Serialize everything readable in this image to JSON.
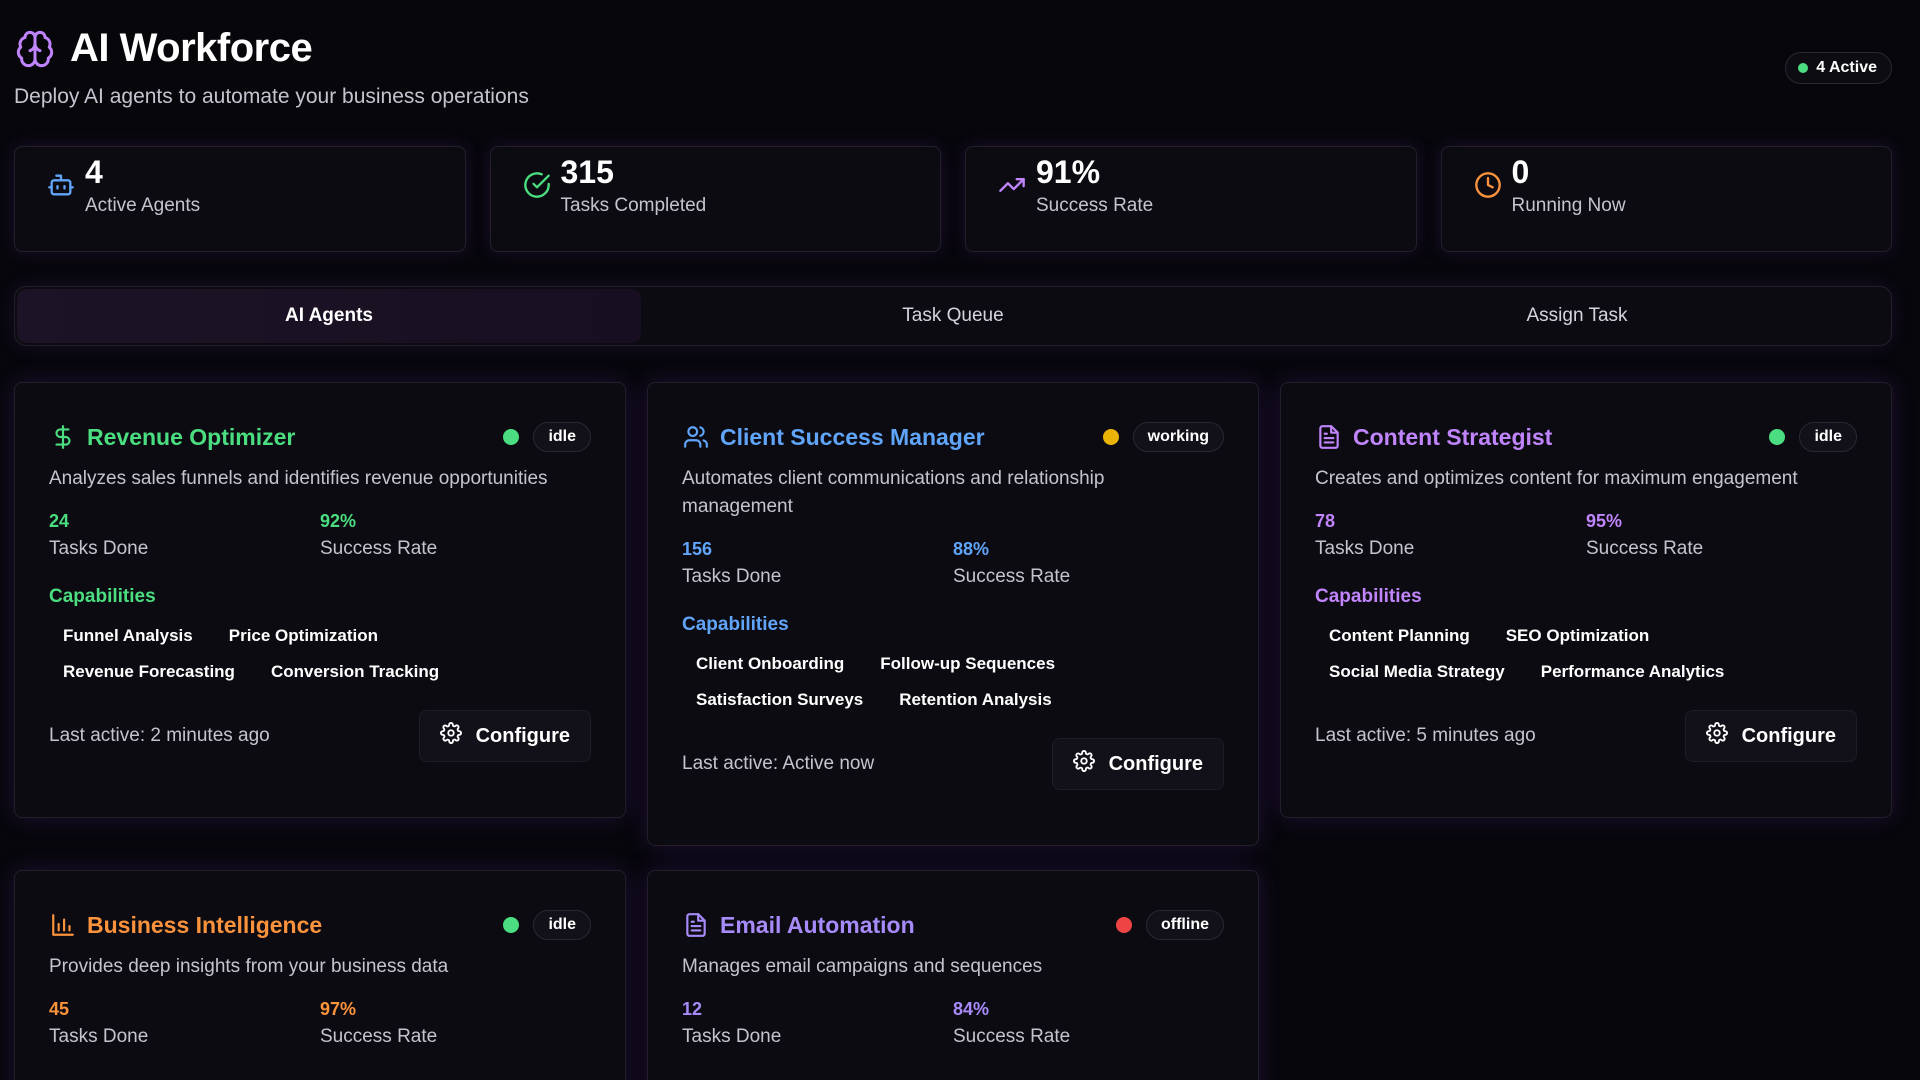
{
  "header": {
    "title": "AI Workforce",
    "subtitle": "Deploy AI agents to automate your business operations",
    "active_badge": "4 Active"
  },
  "colors": {
    "green": "#4ade80",
    "blue": "#60a5fa",
    "purple": "#c084fc",
    "orange": "#fb923c",
    "violet": "#a78bfa",
    "yellow": "#eab308",
    "red": "#ef4444"
  },
  "stats": [
    {
      "icon": "robot-icon",
      "value": "4",
      "label": "Active Agents"
    },
    {
      "icon": "check-circle-icon",
      "value": "315",
      "label": "Tasks Completed"
    },
    {
      "icon": "trending-up-icon",
      "value": "91%",
      "label": "Success Rate"
    },
    {
      "icon": "clock-icon",
      "value": "0",
      "label": "Running Now"
    }
  ],
  "tabs": [
    {
      "label": "AI Agents",
      "active": true
    },
    {
      "label": "Task Queue",
      "active": false
    },
    {
      "label": "Assign Task",
      "active": false
    }
  ],
  "agents": [
    {
      "name": "Revenue Optimizer",
      "icon": "dollar-icon",
      "status": "idle",
      "description": "Analyzes sales funnels and identifies revenue opportunities",
      "tasks_done": "24",
      "tasks_done_label": "Tasks Done",
      "success_rate": "92%",
      "success_rate_label": "Success Rate",
      "capabilities_title": "Capabilities",
      "capabilities": [
        "Funnel Analysis",
        "Price Optimization",
        "Revenue Forecasting",
        "Conversion Tracking"
      ],
      "last_active": "Last active: 2 minutes ago",
      "configure_label": "Configure"
    },
    {
      "name": "Client Success Manager",
      "icon": "users-icon",
      "status": "working",
      "description": "Automates client communications and relationship management",
      "tasks_done": "156",
      "tasks_done_label": "Tasks Done",
      "success_rate": "88%",
      "success_rate_label": "Success Rate",
      "capabilities_title": "Capabilities",
      "capabilities": [
        "Client Onboarding",
        "Follow-up Sequences",
        "Satisfaction Surveys",
        "Retention Analysis"
      ],
      "last_active": "Last active: Active now",
      "configure_label": "Configure"
    },
    {
      "name": "Content Strategist",
      "icon": "document-icon",
      "status": "idle",
      "description": "Creates and optimizes content for maximum engagement",
      "tasks_done": "78",
      "tasks_done_label": "Tasks Done",
      "success_rate": "95%",
      "success_rate_label": "Success Rate",
      "capabilities_title": "Capabilities",
      "capabilities": [
        "Content Planning",
        "SEO Optimization",
        "Social Media Strategy",
        "Performance Analytics"
      ],
      "last_active": "Last active: 5 minutes ago",
      "configure_label": "Configure"
    },
    {
      "name": "Business Intelligence",
      "icon": "bar-chart-icon",
      "status": "idle",
      "description": "Provides deep insights from your business data",
      "tasks_done": "45",
      "tasks_done_label": "Tasks Done",
      "success_rate": "97%",
      "success_rate_label": "Success Rate"
    },
    {
      "name": "Email Automation",
      "icon": "document-icon",
      "status": "offline",
      "description": "Manages email campaigns and sequences",
      "tasks_done": "12",
      "tasks_done_label": "Tasks Done",
      "success_rate": "84%",
      "success_rate_label": "Success Rate"
    }
  ]
}
